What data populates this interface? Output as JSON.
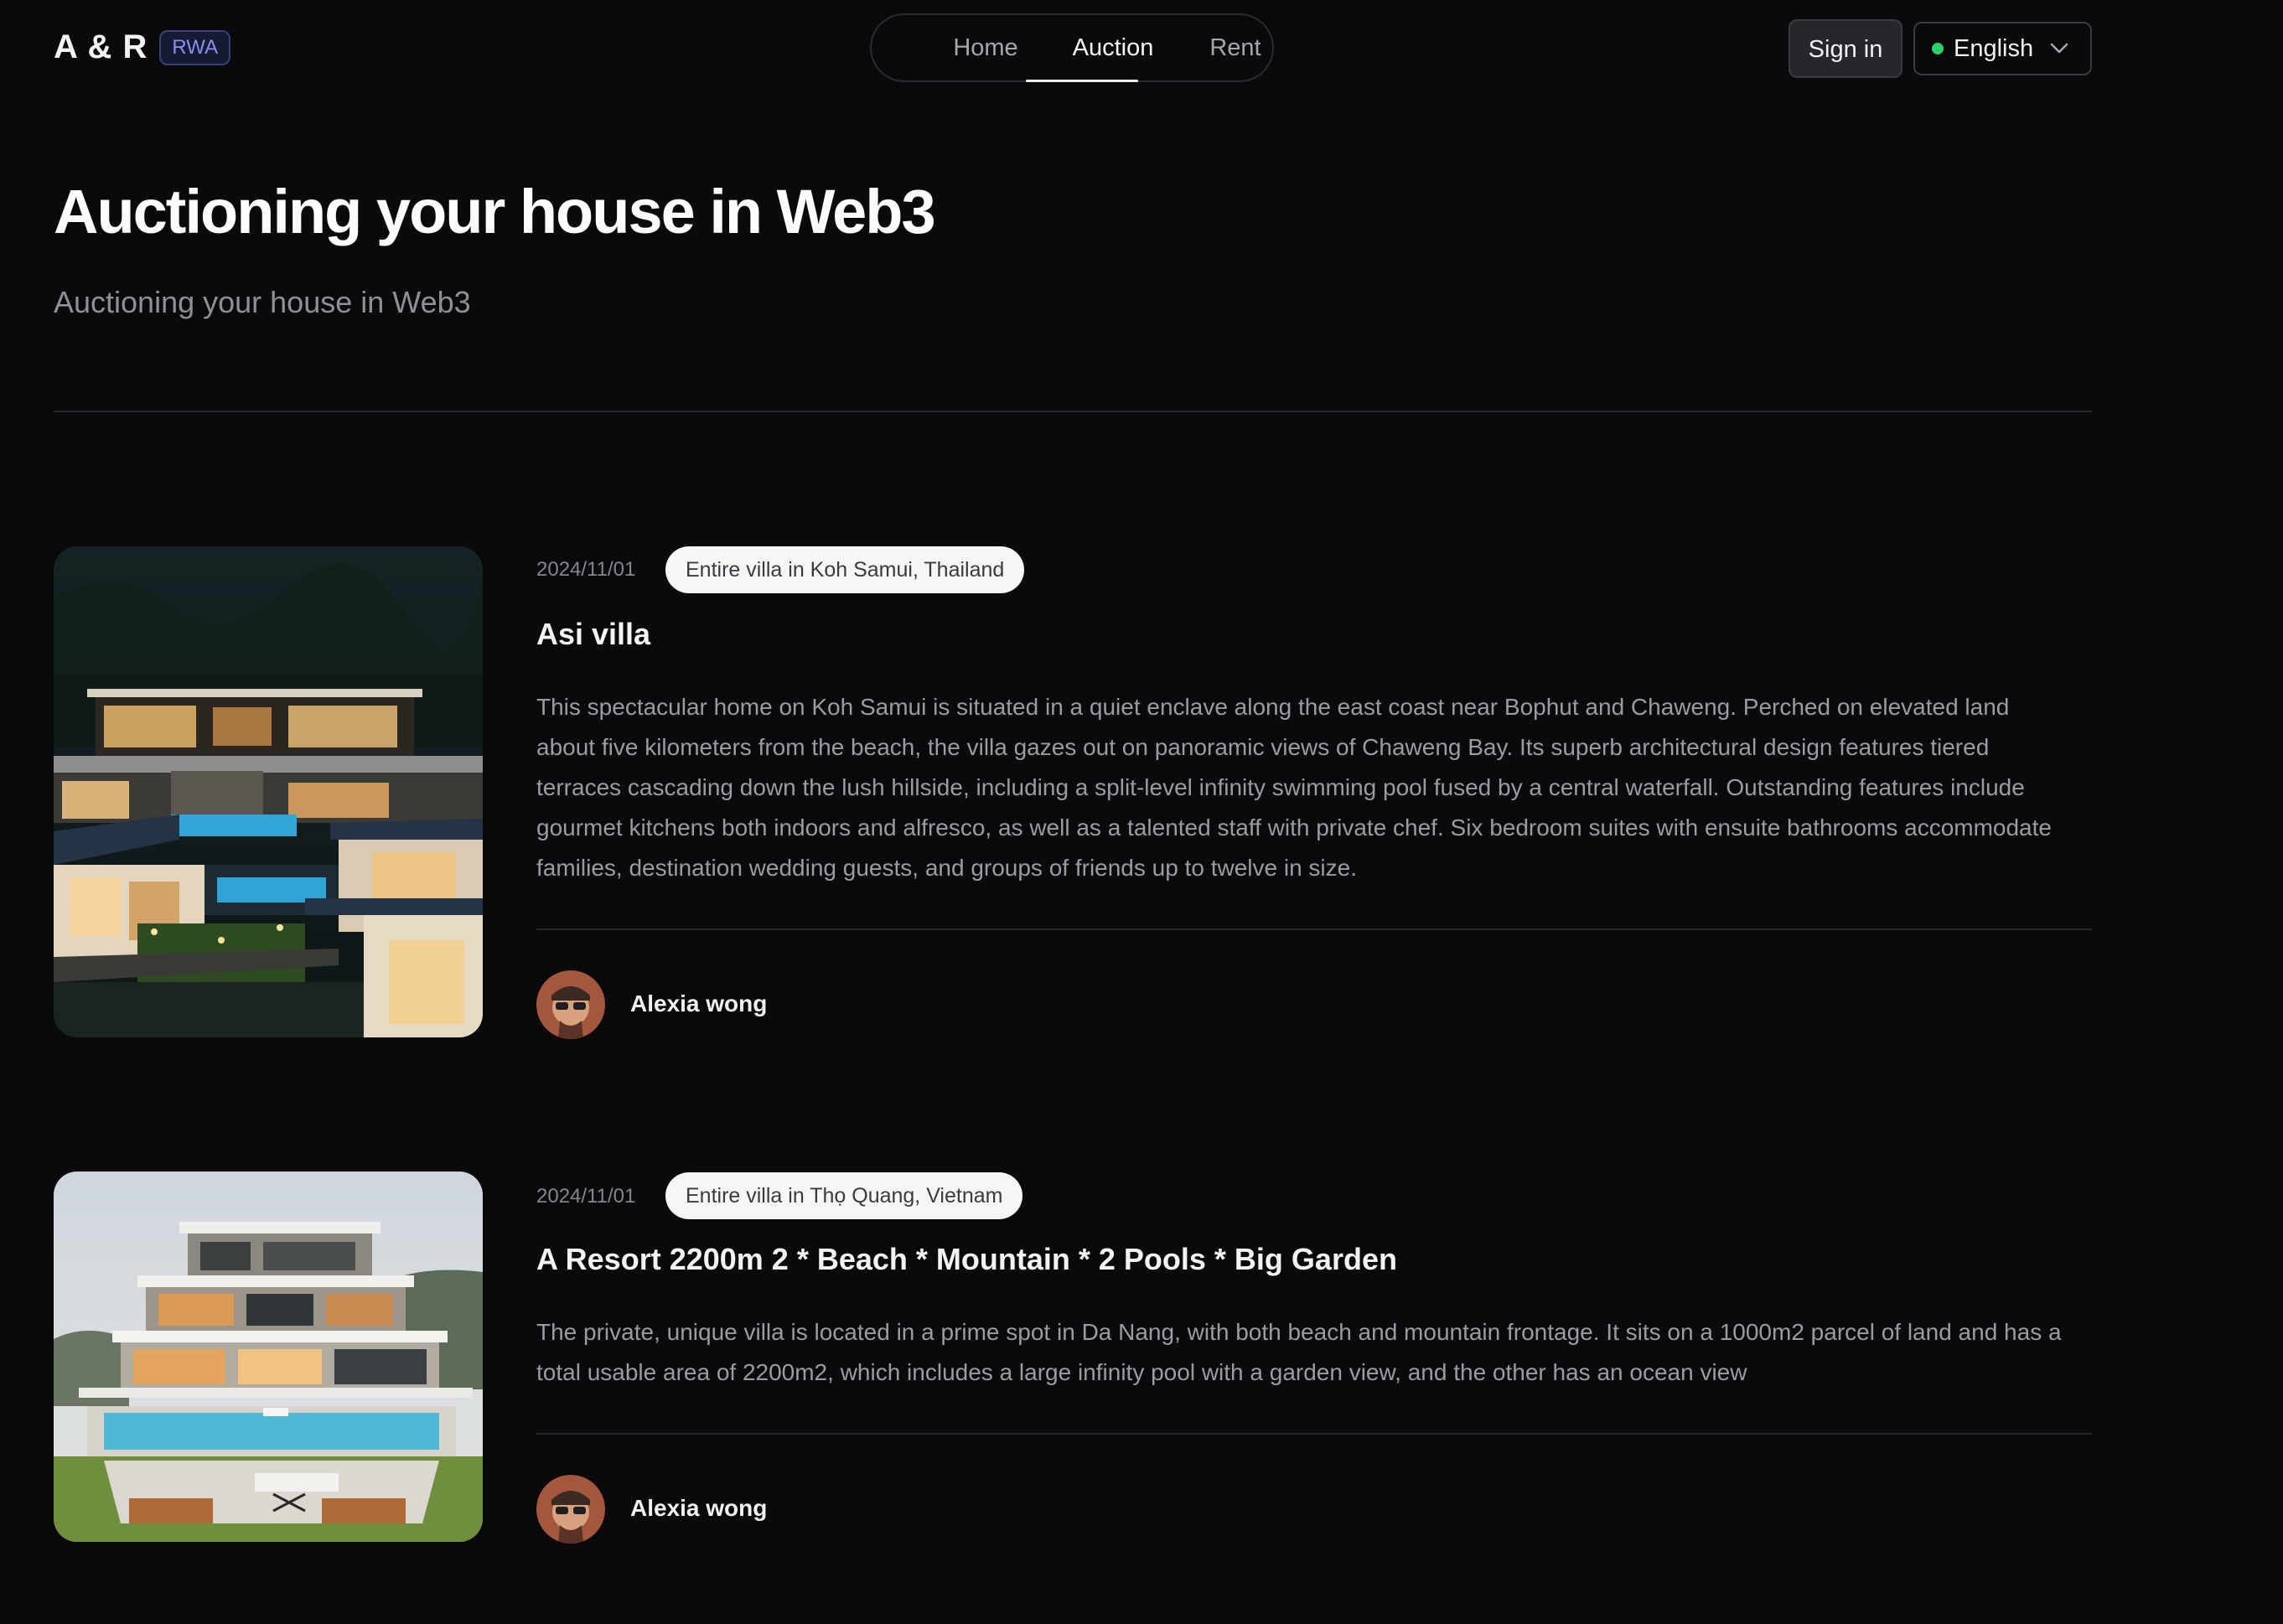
{
  "header": {
    "logo": "A & R",
    "badge": "RWA",
    "nav": [
      {
        "label": "Home",
        "active": false
      },
      {
        "label": "Auction",
        "active": true
      },
      {
        "label": "Rent",
        "active": false
      }
    ],
    "signin_label": "Sign in",
    "language": "English",
    "language_status_color": "#2fd06a"
  },
  "hero": {
    "title": "Auctioning your house in Web3",
    "subtitle": "Auctioning your house in Web3"
  },
  "listings": [
    {
      "date": "2024/11/01",
      "tag": "Entire villa in Koh Samui, Thailand",
      "title": "Asi villa",
      "description": "This spectacular home on Koh Samui is situated in a quiet enclave along the east coast near Bophut and Chaweng. Perched on elevated land about five kilometers from the beach, the villa gazes out on panoramic views of Chaweng Bay. Its superb architectural design features tiered terraces cascading down the lush hillside, including a split-level infinity swimming pool fused by a central waterfall. Outstanding features include gourmet kitchens both indoors and alfresco, as well as a talented staff with private chef. Six bedroom suites with ensuite bathrooms accommodate families, destination wedding guests, and groups of friends up to twelve in size.",
      "author": "Alexia wong"
    },
    {
      "date": "2024/11/01",
      "tag": "Entire villa in Thọ Quang, Vietnam",
      "title": "A Resort 2200m 2 * Beach * Mountain * 2 Pools * Big Garden",
      "description": "The private, unique villa is located in a prime spot in Da Nang, with both beach and mountain frontage. It sits on a 1000m2 parcel of land and has a total usable area of 2200m2, which includes a large infinity pool with a garden view, and the other has an ocean view",
      "author": "Alexia wong"
    }
  ]
}
